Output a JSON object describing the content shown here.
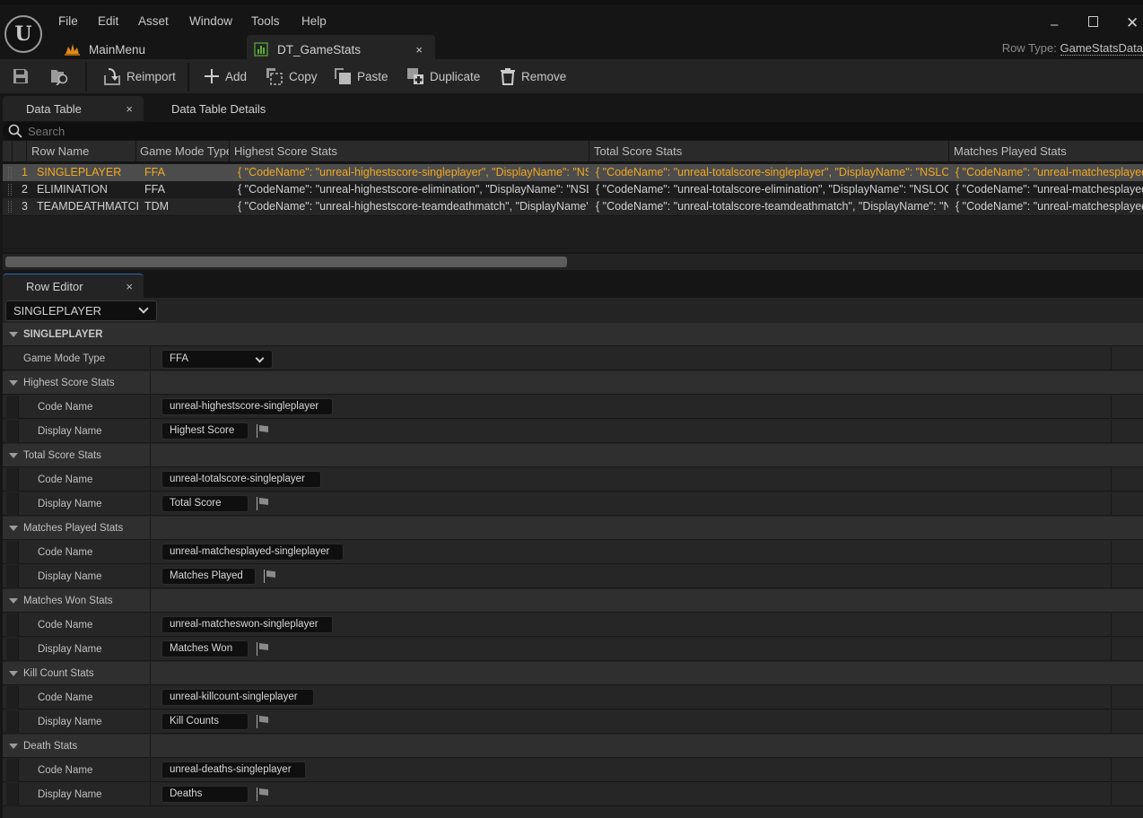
{
  "menu": [
    "File",
    "Edit",
    "Asset",
    "Window",
    "Tools",
    "Help"
  ],
  "doc_tabs": [
    {
      "label": "MainMenu",
      "icon": "level-icon",
      "color": "#e08a1c"
    },
    {
      "label": "DT_GameStats",
      "icon": "datatable-icon",
      "color": "#5fae3a",
      "active": true
    }
  ],
  "row_type": {
    "label": "Row Type:",
    "value": "GameStatsData"
  },
  "toolbar": {
    "save": "save-icon",
    "browse": "browse-icon",
    "reimport": "Reimport",
    "add": "Add",
    "copy": "Copy",
    "paste": "Paste",
    "duplicate": "Duplicate",
    "remove": "Remove"
  },
  "panels": {
    "data_table": "Data Table",
    "data_table_details": "Data Table Details",
    "row_editor": "Row Editor",
    "close": "×"
  },
  "search": {
    "placeholder": "Search"
  },
  "table": {
    "columns": [
      "Row Name",
      "Game Mode Type",
      "Highest Score Stats",
      "Total Score Stats",
      "Matches Played Stats"
    ],
    "rows": [
      {
        "index": "1",
        "name": "SINGLEPLAYER",
        "mode": "FFA",
        "highest": "{ \"CodeName\": \"unreal-highestscore-singleplayer\", \"DisplayName\": \"NSLOCTEXT",
        "total": "{ \"CodeName\": \"unreal-totalscore-singleplayer\", \"DisplayName\": \"NSLOCTEXT",
        "matches": "{ \"CodeName\": \"unreal-matchesplayed-singleplayer\""
      },
      {
        "index": "2",
        "name": "ELIMINATION",
        "mode": "FFA",
        "highest": "{ \"CodeName\": \"unreal-highestscore-elimination\", \"DisplayName\": \"NSLOCTEXT",
        "total": "{ \"CodeName\": \"unreal-totalscore-elimination\", \"DisplayName\": \"NSLOCTEXT",
        "matches": "{ \"CodeName\": \"unreal-matchesplayed-elimination\""
      },
      {
        "index": "3",
        "name": "TEAMDEATHMATCH",
        "mode": "TDM",
        "highest": "{ \"CodeName\": \"unreal-highestscore-teamdeathmatch\", \"DisplayName\": \"NSLOCTEXT",
        "total": "{ \"CodeName\": \"unreal-totalscore-teamdeathmatch\", \"DisplayName\": \"NSLOCTEXT",
        "matches": "{ \"CodeName\": \"unreal-matchesplayed-teamdeathmatch\""
      }
    ]
  },
  "row_editor": {
    "selected_row": "SINGLEPLAYER",
    "category": "SINGLEPLAYER",
    "game_mode_label": "Game Mode Type",
    "game_mode_value": "FFA",
    "code_label": "Code Name",
    "display_label": "Display Name",
    "groups": [
      {
        "title": "Highest Score Stats",
        "code": "unreal-highestscore-singleplayer",
        "display": "Highest Score"
      },
      {
        "title": "Total Score Stats",
        "code": "unreal-totalscore-singleplayer",
        "display": "Total Score"
      },
      {
        "title": "Matches Played Stats",
        "code": "unreal-matchesplayed-singleplayer",
        "display": "Matches Played"
      },
      {
        "title": "Matches Won Stats",
        "code": "unreal-matcheswon-singleplayer",
        "display": "Matches Won"
      },
      {
        "title": "Kill Count Stats",
        "code": "unreal-killcount-singleplayer",
        "display": "Kill Counts"
      },
      {
        "title": "Death Stats",
        "code": "unreal-deaths-singleplayer",
        "display": "Deaths"
      }
    ]
  }
}
